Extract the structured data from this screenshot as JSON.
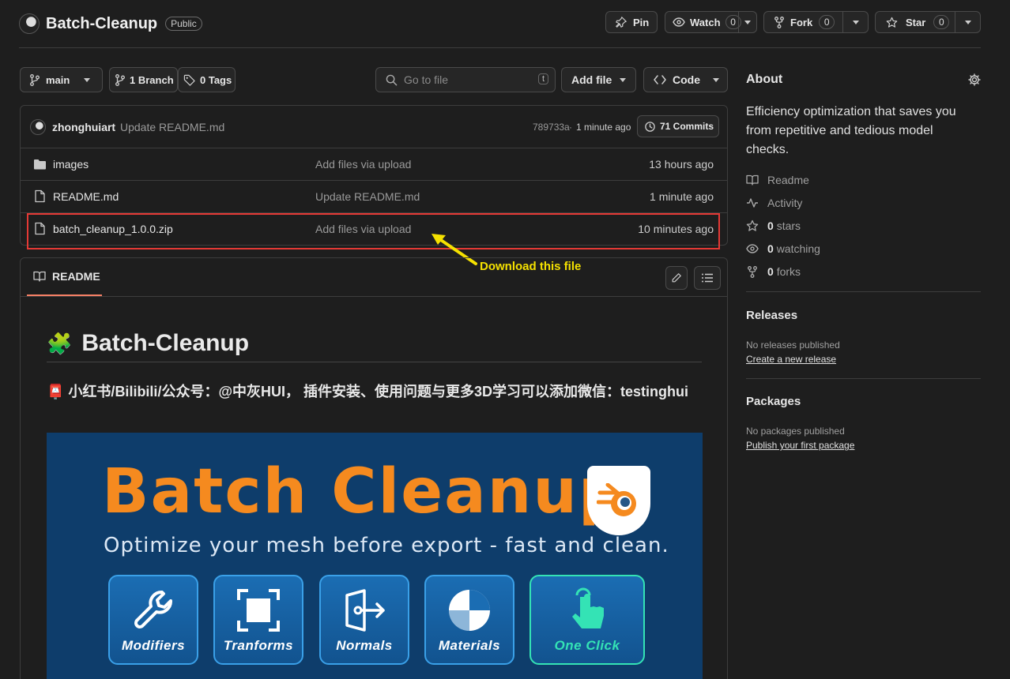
{
  "repo": {
    "name": "Batch-Cleanup",
    "visibility": "Public"
  },
  "actions": {
    "pin": "Pin",
    "watch": "Watch",
    "watch_count": "0",
    "fork": "Fork",
    "fork_count": "0",
    "star": "Star",
    "star_count": "0"
  },
  "toolbar": {
    "branch": "main",
    "branches": "1 Branch",
    "tags": "0 Tags",
    "search_placeholder": "Go to file",
    "search_shortcut": "t",
    "add_file": "Add file",
    "code": "Code"
  },
  "commit": {
    "author": "zhonghuiart",
    "message": "Update README.md",
    "hash": "789733a",
    "separator": "·",
    "time": "1 minute ago",
    "commits": "71 Commits"
  },
  "files": [
    {
      "type": "folder",
      "name": "images",
      "message": "Add files via upload",
      "time": "13 hours ago"
    },
    {
      "type": "file",
      "name": "README.md",
      "message": "Update README.md",
      "time": "1 minute ago"
    },
    {
      "type": "file",
      "name": "batch_cleanup_1.0.0.zip",
      "message": "Add files via upload",
      "time": "10 minutes ago"
    }
  ],
  "annotation": {
    "text": "Download this file",
    "highlight_color": "#e53935",
    "arrow_color": "#f5e100"
  },
  "readme": {
    "tab": "README",
    "title": "Batch-Cleanup",
    "title_emoji": "🧩",
    "subtitle": "小红书/Bilibili/公众号：@中灰HUI， 插件安装、使用问题与更多3D学习可以添加微信：testinghui",
    "subtitle_emoji": "📮",
    "banner": {
      "title": "Batch Cleanup",
      "tagline": "Optimize your mesh before export - fast and clean.",
      "features": [
        "Modifiers",
        "Tranforms",
        "Normals",
        "Materials",
        "One Click"
      ]
    }
  },
  "about": {
    "heading": "About",
    "description": "Efficiency optimization that saves you from repetitive and tedious model checks.",
    "links": [
      {
        "icon": "book-icon",
        "label": "Readme"
      },
      {
        "icon": "pulse-icon",
        "label": "Activity"
      },
      {
        "icon": "star-icon",
        "count": "0",
        "label": "stars"
      },
      {
        "icon": "eye-icon",
        "count": "0",
        "label": "watching"
      },
      {
        "icon": "fork-icon",
        "count": "0",
        "label": "forks"
      }
    ]
  },
  "releases": {
    "heading": "Releases",
    "empty": "No releases published",
    "link": "Create a new release"
  },
  "packages": {
    "heading": "Packages",
    "empty": "No packages published",
    "link": "Publish your first package"
  },
  "colors": {
    "accent_orange": "#f58a1f",
    "banner_bg": "#0e3d6b",
    "one_click": "#34e3b5"
  }
}
